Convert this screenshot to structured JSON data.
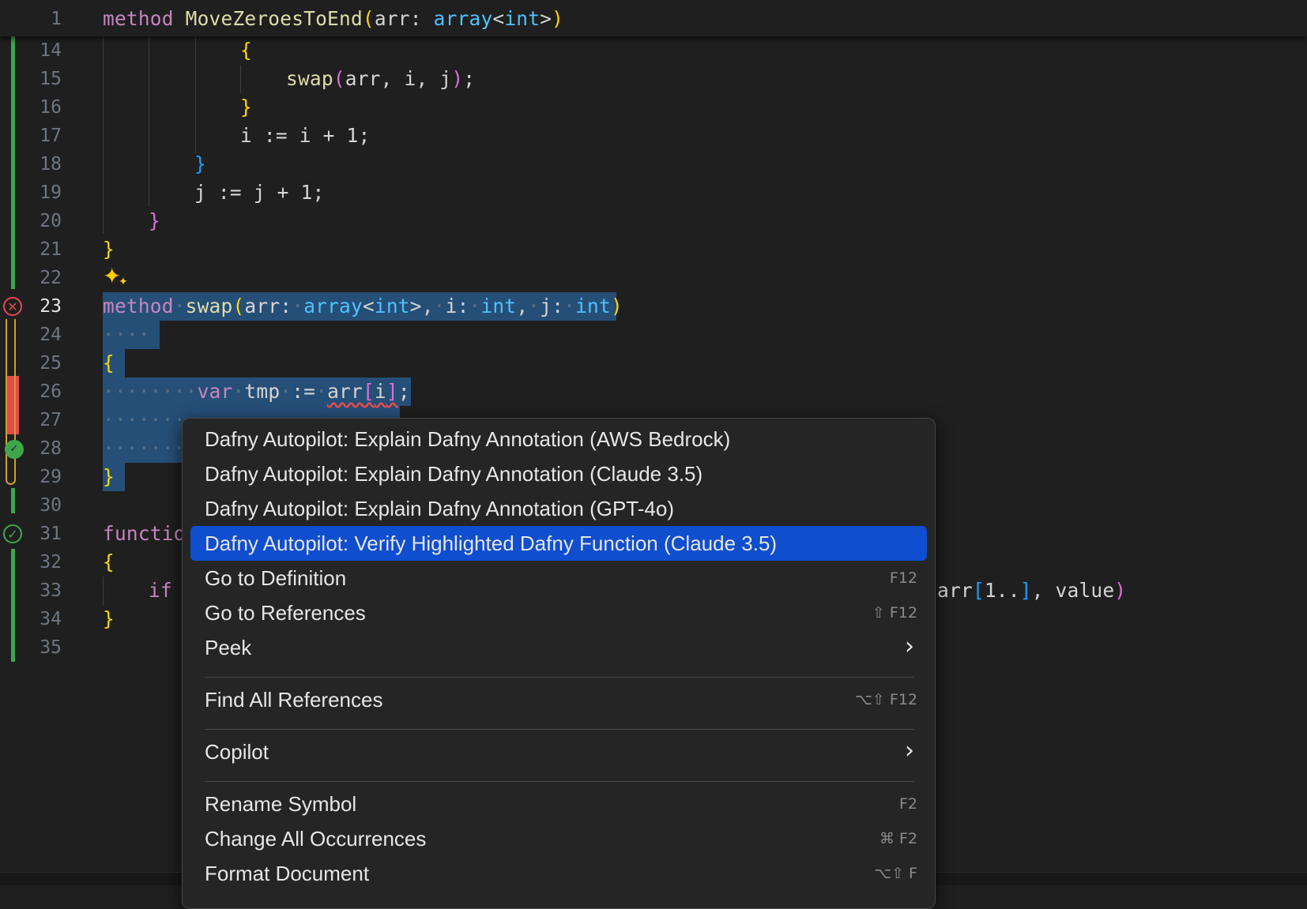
{
  "editor": {
    "sticky_line": {
      "number": "1"
    },
    "line_numbers": [
      "14",
      "15",
      "16",
      "17",
      "18",
      "19",
      "20",
      "21",
      "22",
      "23",
      "24",
      "25",
      "26",
      "27",
      "28",
      "29",
      "30",
      "31",
      "32",
      "33",
      "34",
      "35"
    ],
    "tokens": {
      "t_method": "method",
      "t_move": "MoveZeroesToEnd",
      "t_arr": "arr",
      "t_array": "array",
      "t_int": "int",
      "t_swap": "swap",
      "t_call_args": "arr, i, j",
      "t_i_inc": "i := i + 1;",
      "t_j_inc": "j := j + 1;",
      "t_i": "i",
      "t_j": "j",
      "t_var": "var",
      "t_tmp": "tmp",
      "t_assign": ":=",
      "t_func_partial": "functio",
      "t_if": "if",
      "t_tail_arr": "arr",
      "t_tail_range": "1..",
      "t_tail_value": "value",
      "t_ws4": "····",
      "t_ws8": "········"
    }
  },
  "context_menu": {
    "items": [
      {
        "label": "Dafny Autopilot: Explain Dafny Annotation (AWS Bedrock)",
        "shortcut": ""
      },
      {
        "label": "Dafny Autopilot: Explain Dafny Annotation (Claude 3.5)",
        "shortcut": ""
      },
      {
        "label": "Dafny Autopilot: Explain Dafny Annotation (GPT-4o)",
        "shortcut": ""
      },
      {
        "label": "Dafny Autopilot: Verify Highlighted Dafny Function (Claude 3.5)",
        "shortcut": ""
      },
      {
        "label": "Go to Definition",
        "shortcut": "F12"
      },
      {
        "label": "Go to References",
        "shortcut": "⇧ F12"
      },
      {
        "label": "Peek",
        "shortcut": ""
      },
      {
        "label": "Find All References",
        "shortcut": "⌥⇧ F12"
      },
      {
        "label": "Copilot",
        "shortcut": ""
      },
      {
        "label": "Rename Symbol",
        "shortcut": "F2"
      },
      {
        "label": "Change All Occurrences",
        "shortcut": "⌘ F2"
      },
      {
        "label": "Format Document",
        "shortcut": "⌥⇧ F"
      }
    ],
    "active_index": 3,
    "submenu_glyph": "›"
  },
  "colors": {
    "keyword": "#c586c0",
    "function": "#dcdcaa",
    "type": "#4fc1ff",
    "selection": "#264f78",
    "menu_highlight": "#0f4ecf",
    "verified_green": "#3fa64d",
    "error_red": "#e5484d"
  },
  "icons": {
    "error_gutter": "error-circle-icon",
    "verified_gutter": "check-circle-icon",
    "ai_sparkle": "sparkle-icon"
  }
}
